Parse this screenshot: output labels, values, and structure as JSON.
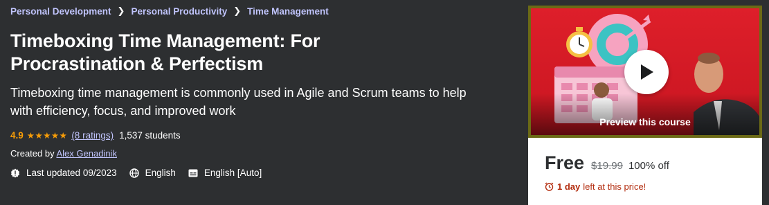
{
  "breadcrumb": [
    "Personal Development",
    "Personal Productivity",
    "Time Management"
  ],
  "course": {
    "title_line1": "Timeboxing Time Management: For",
    "title_line2": "Procrastination & Perfectism",
    "subtitle_line1": "Timeboxing time management is commonly used in Agile and Scrum teams to help",
    "subtitle_line2": "with efficiency, focus, and improved work",
    "rating": "4.9",
    "stars": "★★★★★",
    "ratings_count": "(8 ratings)",
    "students": "1,537 students",
    "created_label": "Created by",
    "author": "Alex Genadinik",
    "last_updated": "Last updated 09/2023",
    "language": "English",
    "captions": "English [Auto]"
  },
  "card": {
    "preview_label": "Preview this course",
    "price": "Free",
    "original_price": "$19.99",
    "discount": "100% off",
    "timer_bold": "1 day",
    "timer_rest": "left at this price!"
  },
  "colors": {
    "background": "#2d2f31",
    "link": "#c0c4fc",
    "star": "#f69c08",
    "alert": "#b32d0f"
  },
  "icons": [
    "chevron-right-icon",
    "star-icon",
    "alert-badge-icon",
    "globe-icon",
    "captions-icon",
    "play-icon",
    "alarm-clock-icon"
  ]
}
